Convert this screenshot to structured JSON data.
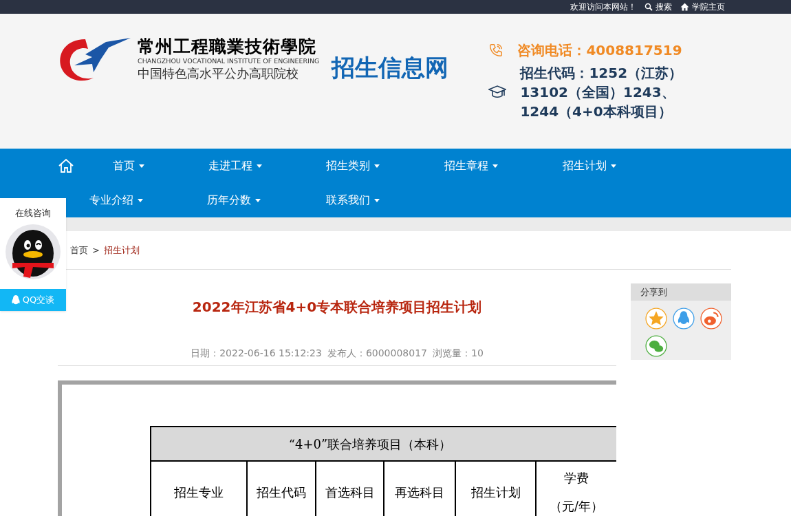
{
  "top_bar": {
    "welcome": "欢迎访问本网站！",
    "links": [
      {
        "kind": "search",
        "label": "搜索"
      },
      {
        "kind": "home",
        "label": "学院主页"
      }
    ]
  },
  "header": {
    "logo_name": "常州工程職業技術學院",
    "logo_english": "CHANGZHOU VOCATIONAL INSTITUTE OF ENGINEERING",
    "logo_slogan": "中国特色高水平公办高职院校",
    "site_title": "招生信息网",
    "phone": "咨询电话：4008817519",
    "codes": [
      "招生代码：1252（江苏）",
      "13102（全国）1243、",
      "1244（4+0本科项目）"
    ]
  },
  "nav": {
    "rows": [
      [
        {
          "label": "首页"
        },
        {
          "label": "走进工程"
        },
        {
          "label": "招生类别"
        },
        {
          "label": "招生章程"
        },
        {
          "label": "招生计划"
        }
      ],
      [
        {
          "label": "专业介绍"
        },
        {
          "label": "历年分数"
        },
        {
          "label": "联系我们"
        }
      ]
    ]
  },
  "consult_widget": {
    "title": "在线咨询",
    "button": "QQ交谈"
  },
  "breadcrumb": [
    {
      "label": "首页",
      "selected": false
    },
    {
      "label": "招生计划",
      "selected": true
    }
  ],
  "breadcrumb_separator": ">",
  "article": {
    "title": "2022年江苏省4+0专本联合培养项目招生计划",
    "meta": [
      "日期：2022-06-16 15:12:23",
      "发布人：6000008017",
      "浏览量：10"
    ],
    "table": {
      "caption": "“4+0”联合培养项目（本科）",
      "columns": [
        "招生专业",
        "招生代码",
        "首选科目",
        "再选科目",
        "招生计划",
        "学费"
      ],
      "fee_unit": "（元/年）"
    }
  },
  "share": {
    "title": "分享到",
    "icons": [
      {
        "kind": "star",
        "color": "#f5a623"
      },
      {
        "kind": "qq",
        "color": "#3d9ee8"
      },
      {
        "kind": "weibo",
        "color": "#f0602d"
      },
      {
        "kind": "wechat",
        "color": "#4cae3f"
      }
    ]
  }
}
